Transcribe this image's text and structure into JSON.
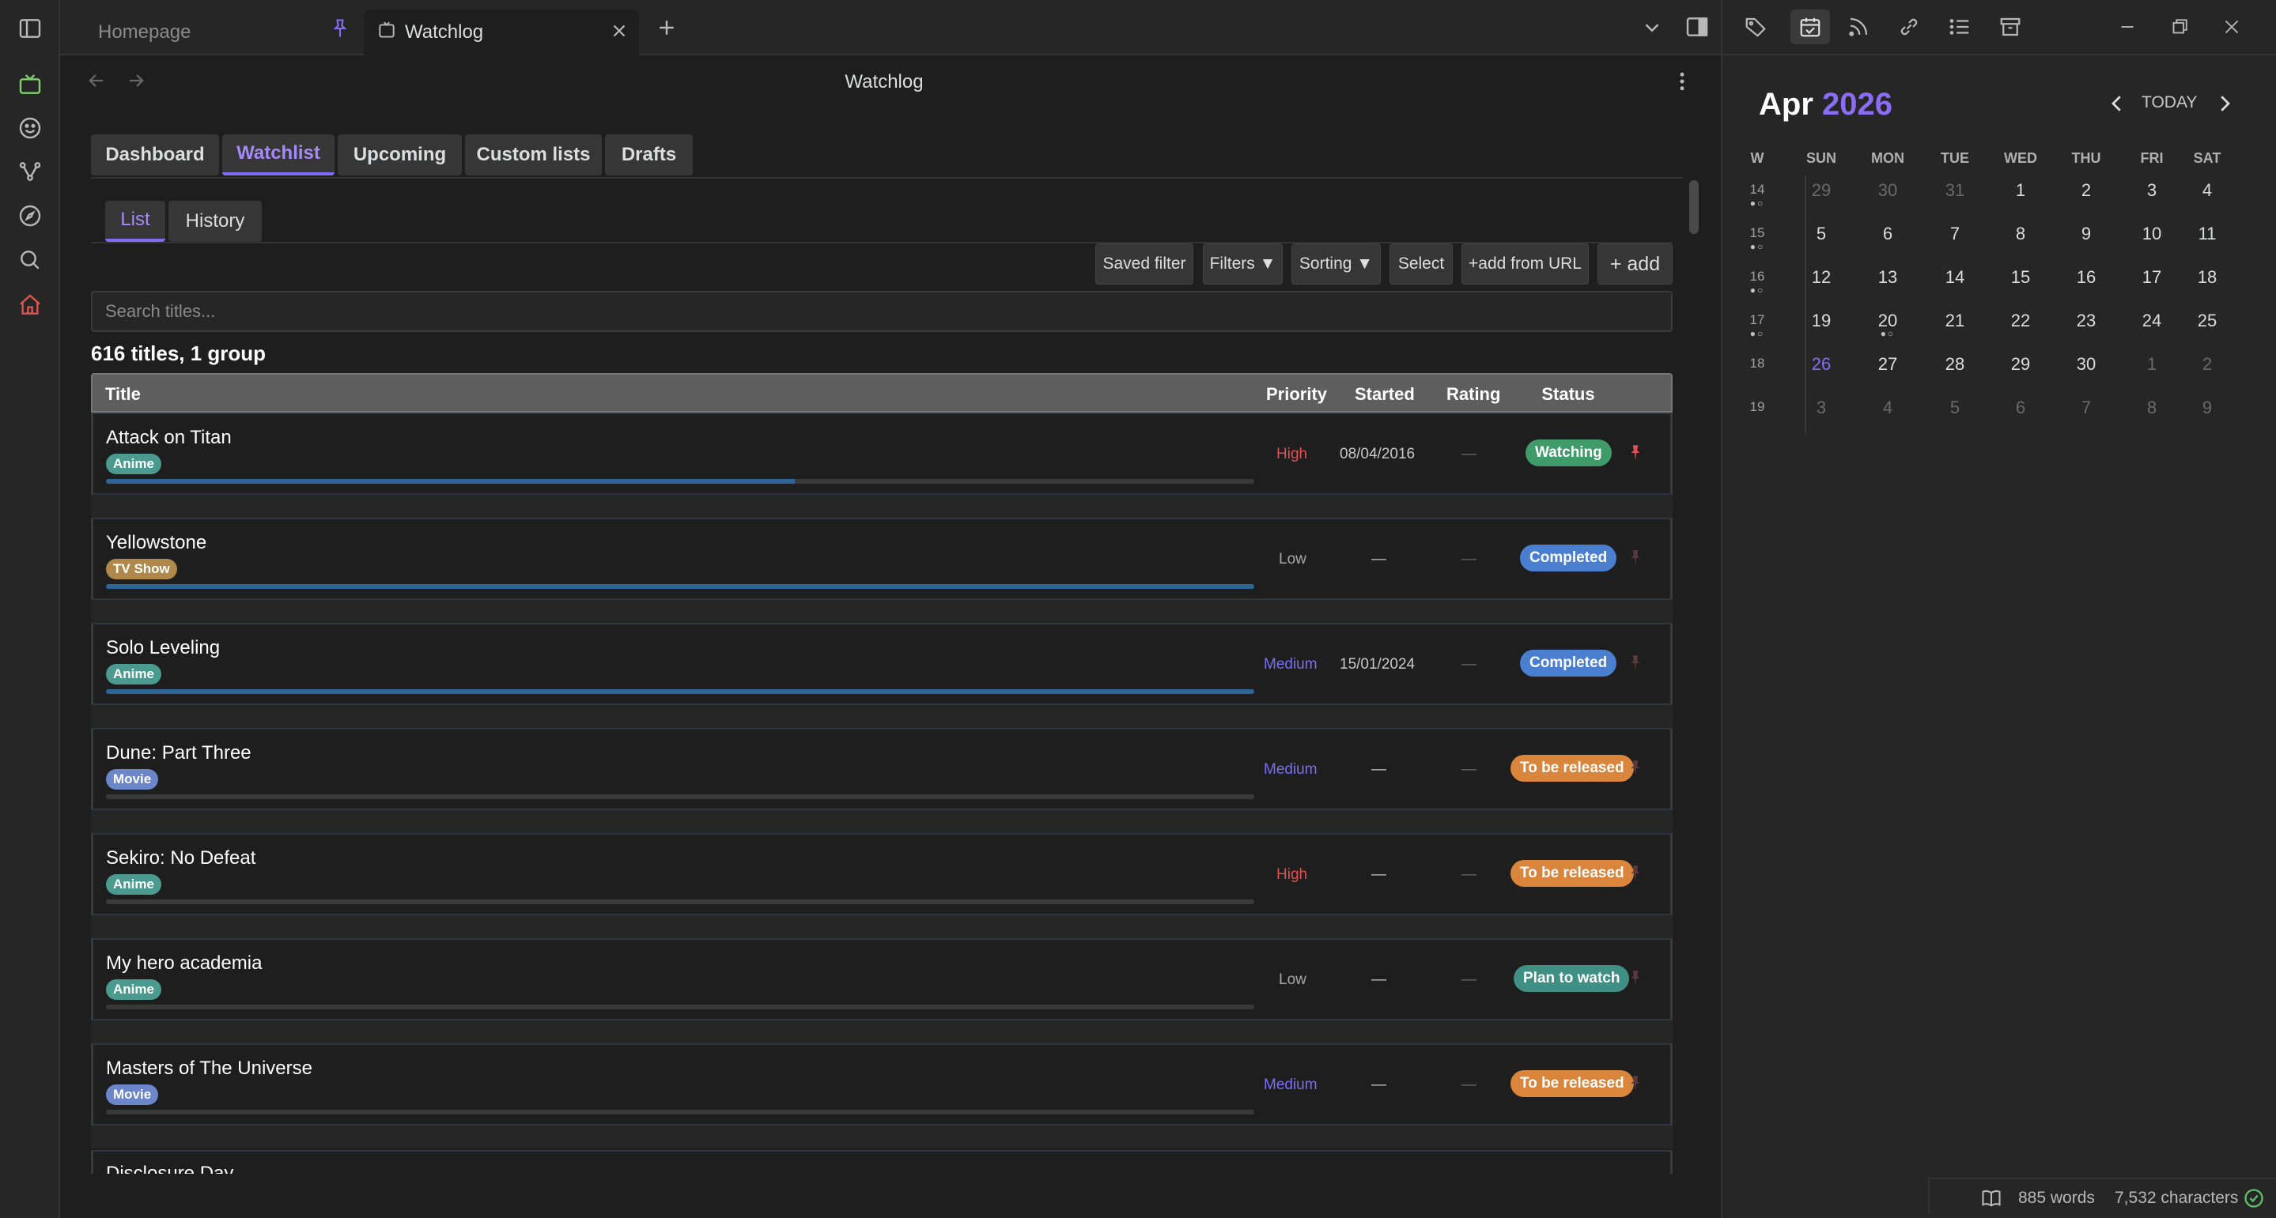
{
  "tabs": [
    {
      "label": "Homepage"
    },
    {
      "label": "Watchlog"
    }
  ],
  "header": {
    "title": "Watchlog"
  },
  "view_tabs": [
    "Dashboard",
    "Watchlist",
    "Upcoming",
    "Custom lists",
    "Drafts"
  ],
  "sub_tabs": [
    "List",
    "History"
  ],
  "toolbar": {
    "saved_filter": "Saved filter",
    "filters": "Filters ▼",
    "sorting": "Sorting ▼",
    "select": "Select",
    "add_url": "+add from URL",
    "add": "+ add"
  },
  "search": {
    "placeholder": "Search titles..."
  },
  "summary": "616 titles, 1 group",
  "columns": {
    "title": "Title",
    "priority": "Priority",
    "started": "Started",
    "rating": "Rating",
    "status": "Status"
  },
  "rows": [
    {
      "title": "Attack on Titan",
      "type": "Anime",
      "priority": "High",
      "started": "08/04/2016",
      "rating": "—",
      "status": "Watching",
      "progress": 0.6
    },
    {
      "title": "Yellowstone",
      "type": "TV Show",
      "priority": "Low",
      "started": "—",
      "rating": "—",
      "status": "Completed",
      "progress": 1.0
    },
    {
      "title": "Solo Leveling",
      "type": "Anime",
      "priority": "Medium",
      "started": "15/01/2024",
      "rating": "—",
      "status": "Completed",
      "progress": 1.0
    },
    {
      "title": "Dune: Part Three",
      "type": "Movie",
      "priority": "Medium",
      "started": "—",
      "rating": "—",
      "status": "To be released",
      "progress": 0
    },
    {
      "title": "Sekiro: No Defeat",
      "type": "Anime",
      "priority": "High",
      "started": "—",
      "rating": "—",
      "status": "To be released",
      "progress": 0
    },
    {
      "title": "My hero academia",
      "type": "Anime",
      "priority": "Low",
      "started": "—",
      "rating": "—",
      "status": "Plan to watch",
      "progress": 0
    },
    {
      "title": "Masters of The Universe",
      "type": "Movie",
      "priority": "Medium",
      "started": "—",
      "rating": "—",
      "status": "To be released",
      "progress": 0
    }
  ],
  "partial_row_title": "Disclosure Day",
  "calendar": {
    "month": "Apr",
    "year": "2026",
    "today_label": "TODAY",
    "weekdays": [
      "W",
      "SUN",
      "MON",
      "TUE",
      "WED",
      "THU",
      "FRI",
      "SAT"
    ],
    "weeks": [
      {
        "wk": "14",
        "days": [
          "29",
          "30",
          "31",
          "1",
          "2",
          "3",
          "4"
        ]
      },
      {
        "wk": "15",
        "days": [
          "5",
          "6",
          "7",
          "8",
          "9",
          "10",
          "11"
        ]
      },
      {
        "wk": "16",
        "days": [
          "12",
          "13",
          "14",
          "15",
          "16",
          "17",
          "18"
        ]
      },
      {
        "wk": "17",
        "days": [
          "19",
          "20",
          "21",
          "22",
          "23",
          "24",
          "25"
        ]
      },
      {
        "wk": "18",
        "days": [
          "26",
          "27",
          "28",
          "29",
          "30",
          "1",
          "2"
        ]
      },
      {
        "wk": "19",
        "days": [
          "3",
          "4",
          "5",
          "6",
          "7",
          "8",
          "9"
        ]
      }
    ]
  },
  "status_bar": {
    "words": "885 words",
    "chars": "7,532 characters"
  },
  "colors": {
    "accent": "#8b6cf7",
    "anime": "#4a9a8f",
    "tvshow": "#b0894a",
    "movie": "#6b86c9",
    "watching": "#3f9c6a",
    "completed": "#4a7fd0",
    "to_be_released": "#d9853b",
    "plan_to_watch": "#3f8f85",
    "high": "#e05252",
    "medium": "#7a6ff0",
    "low": "#a8a8a8"
  }
}
